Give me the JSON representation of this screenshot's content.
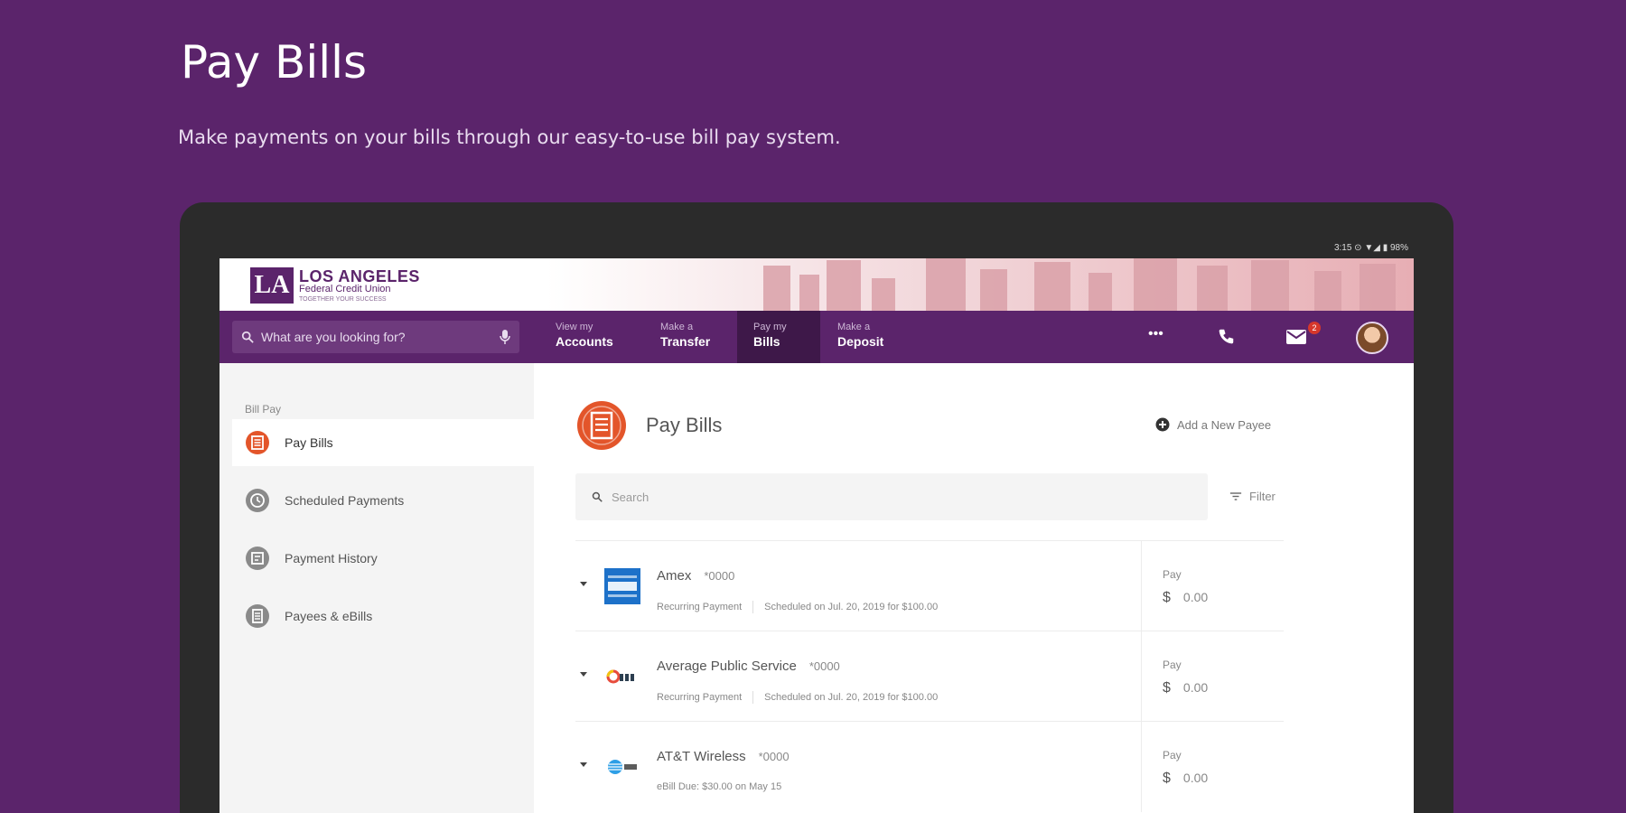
{
  "page": {
    "headline": "Pay Bills",
    "subline": "Make payments on your bills through our easy-to-use bill pay system."
  },
  "device": {
    "status_text": "3:15 ⊙ ▼◢ ▮ 98%"
  },
  "brand": {
    "logo_mark": "LA",
    "logo_line1": "LOS ANGELES",
    "logo_line2": "Federal Credit Union",
    "logo_line3": "TOGETHER YOUR SUCCESS",
    "primary_color": "#5b246b",
    "accent_color": "#e3552a"
  },
  "nav": {
    "search_placeholder": "What are you looking for?",
    "links": [
      {
        "small": "View my",
        "big": "Accounts"
      },
      {
        "small": "Make a",
        "big": "Transfer"
      },
      {
        "small": "Pay my",
        "big": "Bills"
      },
      {
        "small": "Make a",
        "big": "Deposit"
      }
    ],
    "more_label": "•••",
    "mail_badge": "2"
  },
  "sidebar": {
    "heading": "Bill Pay",
    "items": [
      {
        "label": "Pay Bills",
        "icon": "bill-icon"
      },
      {
        "label": "Scheduled Payments",
        "icon": "clock-icon"
      },
      {
        "label": "Payment History",
        "icon": "history-icon"
      },
      {
        "label": "Payees & eBills",
        "icon": "list-icon"
      }
    ]
  },
  "main": {
    "title": "Pay Bills",
    "add_payee": "Add a New Payee",
    "search_placeholder": "Search",
    "filter": "Filter",
    "payees": [
      {
        "name": "Amex",
        "acct": "*0000",
        "meta1": "Recurring Payment",
        "meta2": "Scheduled on Jul. 20, 2019 for $100.00",
        "pay_label": "Pay",
        "amount": "0.00",
        "logo": "amex-logo"
      },
      {
        "name": "Average Public Service",
        "acct": "*0000",
        "meta1": "Recurring Payment",
        "meta2": "Scheduled on Jul. 20, 2019 for $100.00",
        "pay_label": "Pay",
        "amount": "0.00",
        "logo": "aps-logo"
      },
      {
        "name": "AT&T Wireless",
        "acct": "*0000",
        "meta1": "eBill Due: $30.00 on May 15",
        "meta2": "",
        "pay_label": "Pay",
        "amount": "0.00",
        "logo": "att-logo"
      }
    ]
  }
}
